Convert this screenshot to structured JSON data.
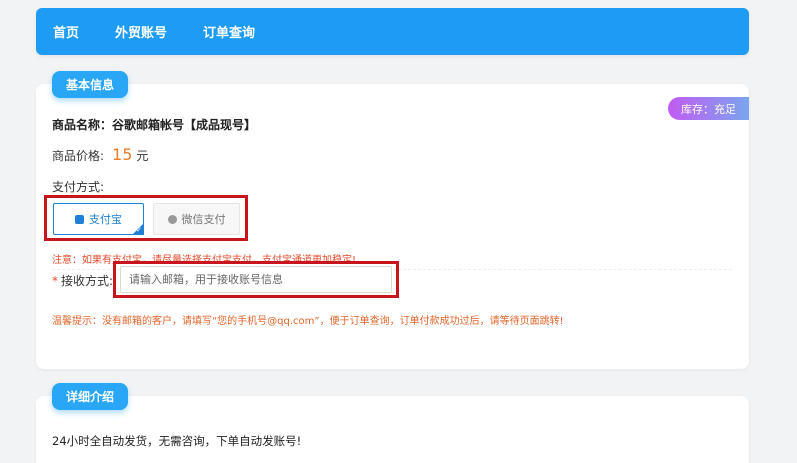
{
  "nav": {
    "items": [
      {
        "label": "首页"
      },
      {
        "label": "外贸账号"
      },
      {
        "label": "订单查询"
      }
    ]
  },
  "info_section": {
    "title": "基本信息",
    "stock_badge": "库存：充足",
    "product_name": "商品名称：谷歌邮箱帐号【成品现号】",
    "price_label": "商品价格:",
    "price_value": "15",
    "price_unit": "元",
    "pay_label": "支付方式:",
    "pay_options": [
      {
        "label": "支付宝",
        "selected": true,
        "icon": "alipay-icon"
      },
      {
        "label": "微信支付",
        "selected": false,
        "icon": "wechat-icon"
      }
    ],
    "notice": "注意：如果有支付宝，请尽量选择支付宝支付，支付宝通道更加稳定!",
    "receive_required": "*",
    "receive_label": "接收方式:",
    "receive_placeholder": "请输入邮箱，用于接收账号信息",
    "tip": "温馨提示：没有邮箱的客户，请填写“您的手机号@qq.com”，便于订单查询，订单付款成功过后，请等待页面跳转!"
  },
  "detail_section": {
    "title": "详细介绍",
    "text": "24小时全自动发货，无需咨询，下单自动发账号!"
  },
  "colors": {
    "nav_bg": "#1e9bf5",
    "accent_blue": "#1e80d6",
    "price_orange": "#f07b2b",
    "warning_red": "#e54b2c",
    "highlight_box": "#c8151d"
  }
}
